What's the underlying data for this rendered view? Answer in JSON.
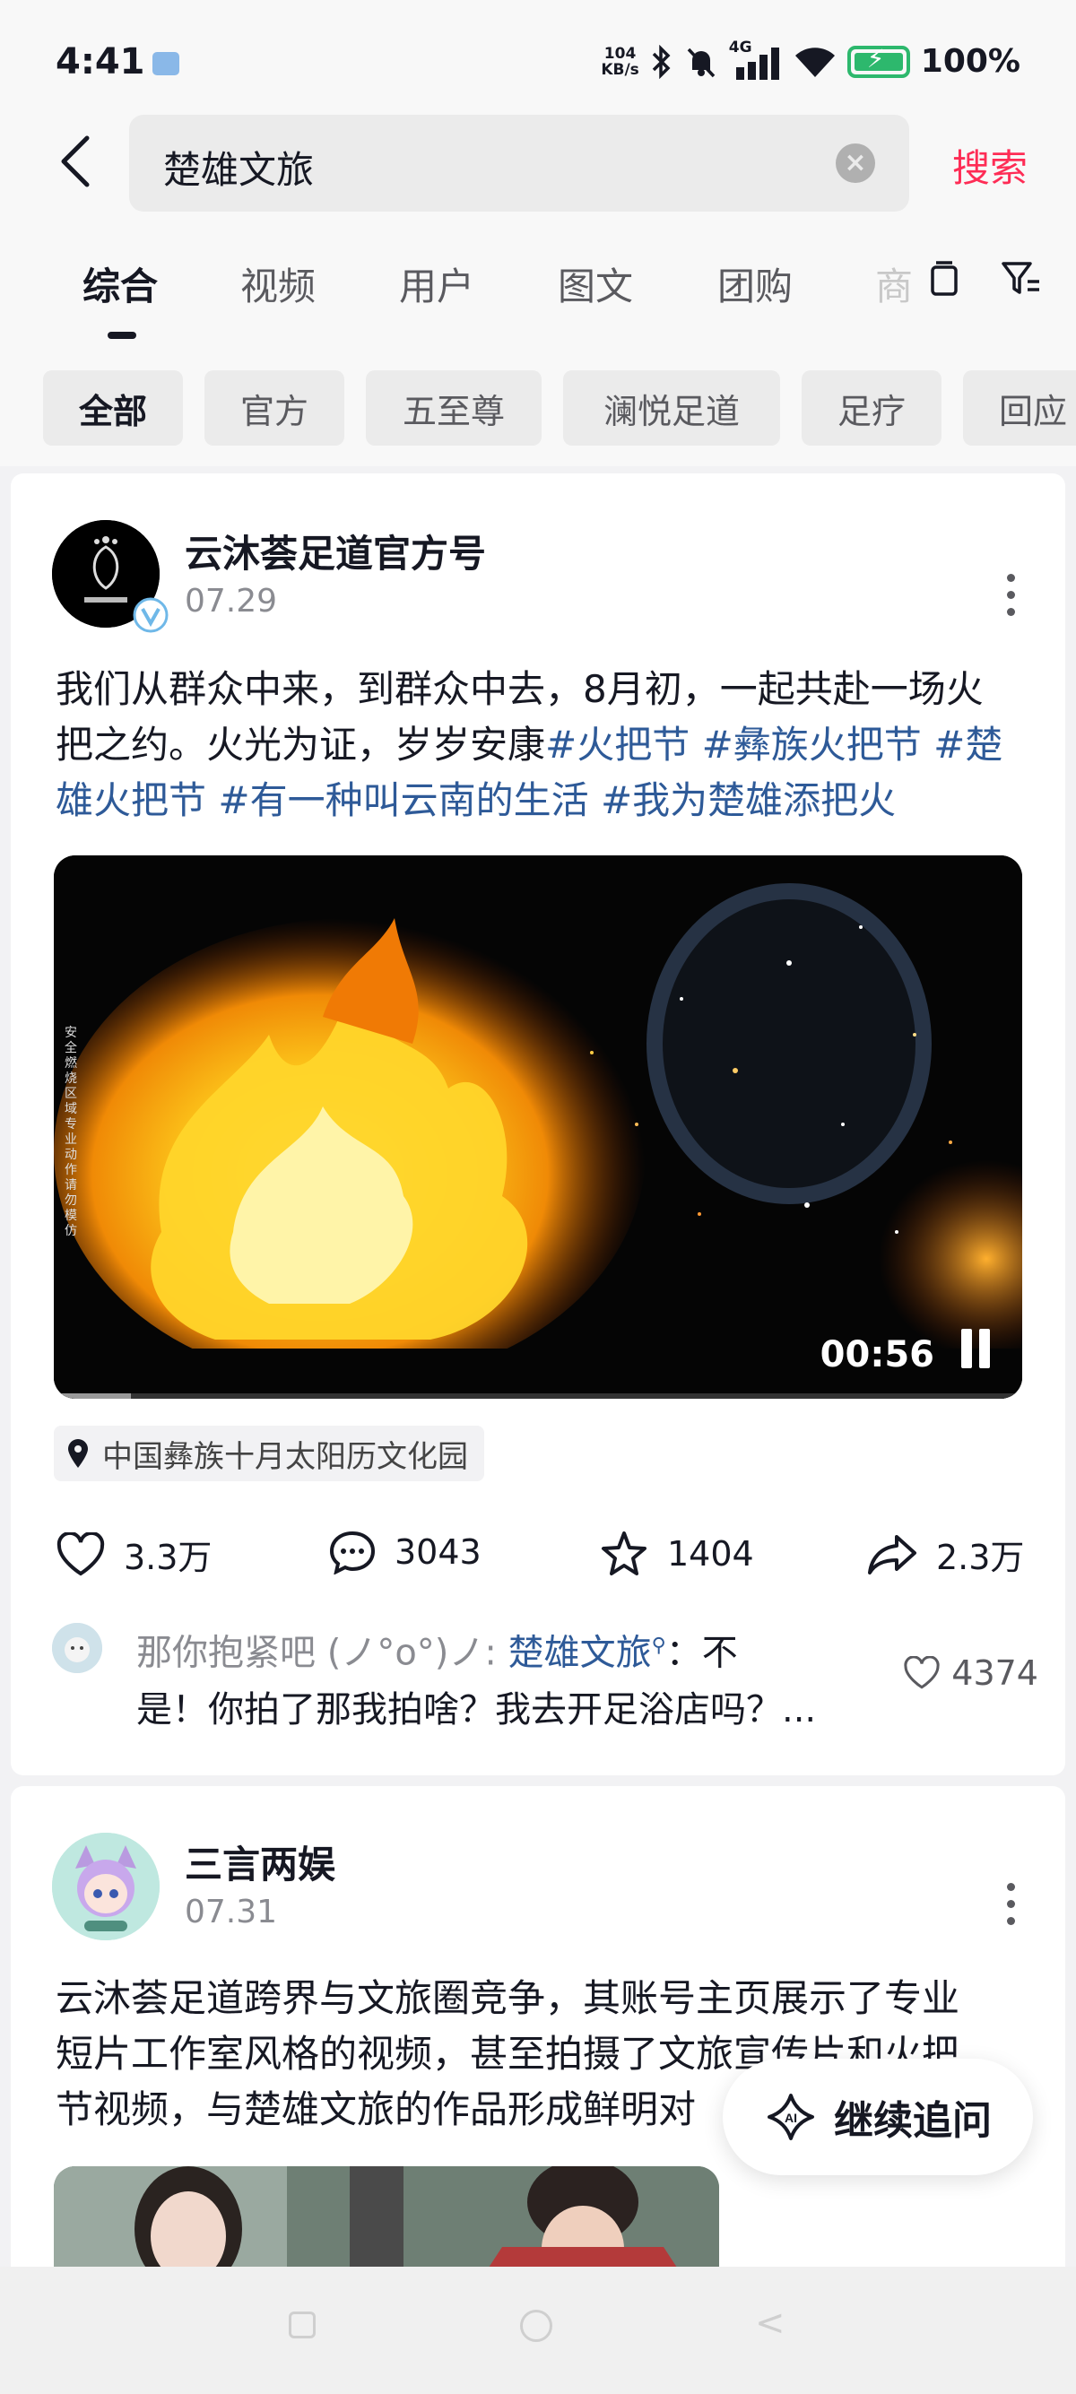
{
  "status_bar": {
    "time": "4:41",
    "net_speed_value": "104",
    "net_speed_unit": "KB/s",
    "network": "4G",
    "battery": "100%"
  },
  "search": {
    "query": "楚雄文旅",
    "submit_label": "搜索"
  },
  "tabs": [
    {
      "label": "综合",
      "active": true
    },
    {
      "label": "视频"
    },
    {
      "label": "用户"
    },
    {
      "label": "图文"
    },
    {
      "label": "团购"
    },
    {
      "label": "商"
    }
  ],
  "filters": [
    "全部",
    "官方",
    "五至尊",
    "澜悦足道",
    "足疗",
    "回应"
  ],
  "post1": {
    "username": "云沐荟足道官方号",
    "date": "07.29",
    "text_line1": "我们从群众中来，到群众中去，8月初，一起共赴一场火",
    "text_line2_plain": "把之约。火光为证，岁岁安康",
    "tags": [
      "#火把节",
      "#彝族火把节",
      "#楚雄火把节",
      "#有一种叫云南的生活",
      "#我为楚雄添把火"
    ],
    "video_duration": "00:56",
    "video_side_text": "安全燃烧区域 专业动作 请勿模仿",
    "video_progress": 0.08,
    "location": "中国彝族十月太阳历文化园",
    "likes": "3.3万",
    "comments": "3043",
    "favorites": "1404",
    "shares": "2.3万",
    "top_comment": {
      "author": "那你抱紧吧 (ノ°ο°)ノ:",
      "mention": "楚雄文旅",
      "line1_text": "：不",
      "line2": "是！你拍了那我拍啥？我去开足浴店吗？...",
      "likes": "4374"
    }
  },
  "post2": {
    "username": "三言两娱",
    "date": "07.31",
    "text_line1": "云沐荟足道跨界与文旅圈竞争，其账号主页展示了专业",
    "text_line2": "短片工作室风格的视频，甚至拍摄了文旅宣传片和火把",
    "text_line3": "节视频，与楚雄文旅的作品形成鲜明对"
  },
  "ai_button": {
    "label": "继续追问"
  },
  "colors": {
    "accent": "#fe2c55",
    "tag": "#2e5a98",
    "verified": "#6fb8e8"
  }
}
